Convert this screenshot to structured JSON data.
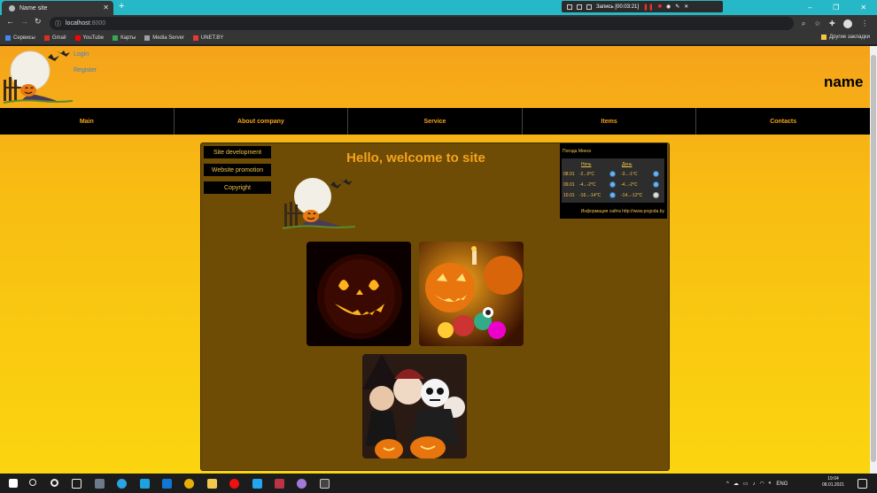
{
  "browser": {
    "tab_title": "Name site",
    "new_tab": "+",
    "url_host": "localhost",
    "url_port": ":8000",
    "record": {
      "label": "Запись [00:03:21]"
    },
    "bookmarks": [
      {
        "label": "Сервисы",
        "color": "#4285f4"
      },
      {
        "label": "Gmail",
        "color": "#d93025"
      },
      {
        "label": "YouTube",
        "color": "#ff0000"
      },
      {
        "label": "Карты",
        "color": "#34a853"
      },
      {
        "label": "Media Server",
        "color": "#9aa0a6"
      },
      {
        "label": "UNET.BY",
        "color": "#e53935"
      }
    ],
    "other_bookmarks": "Другие закладки"
  },
  "header": {
    "login": "Login",
    "register": "Register",
    "site_name": "name"
  },
  "nav": {
    "items": [
      "Main",
      "About company",
      "Service",
      "Items",
      "Contacts"
    ]
  },
  "sidebar": {
    "items": [
      "Site development",
      "Website promotion",
      "Copyright"
    ]
  },
  "main": {
    "welcome": "Hello, welcome to site"
  },
  "weather": {
    "title": "Погода Минск",
    "night_header": "Ночь",
    "day_header": "День",
    "rows": [
      {
        "date": "08.01",
        "night": "-2...0°C",
        "day": "-3...-1°C"
      },
      {
        "date": "09.01",
        "night": "-4...-2°C",
        "day": "-4...-2°C"
      },
      {
        "date": "10.01",
        "night": "-16...-14°C",
        "day": "-14...-12°C"
      }
    ],
    "source": "Информация сайта http://www.pogoda.by"
  },
  "taskbar": {
    "lang": "ENG",
    "time": "19:04",
    "date": "08.01.2021"
  },
  "colors": {
    "accent": "#f5a31a",
    "panel": "#6e4c05",
    "nav_bg": "#000000"
  }
}
